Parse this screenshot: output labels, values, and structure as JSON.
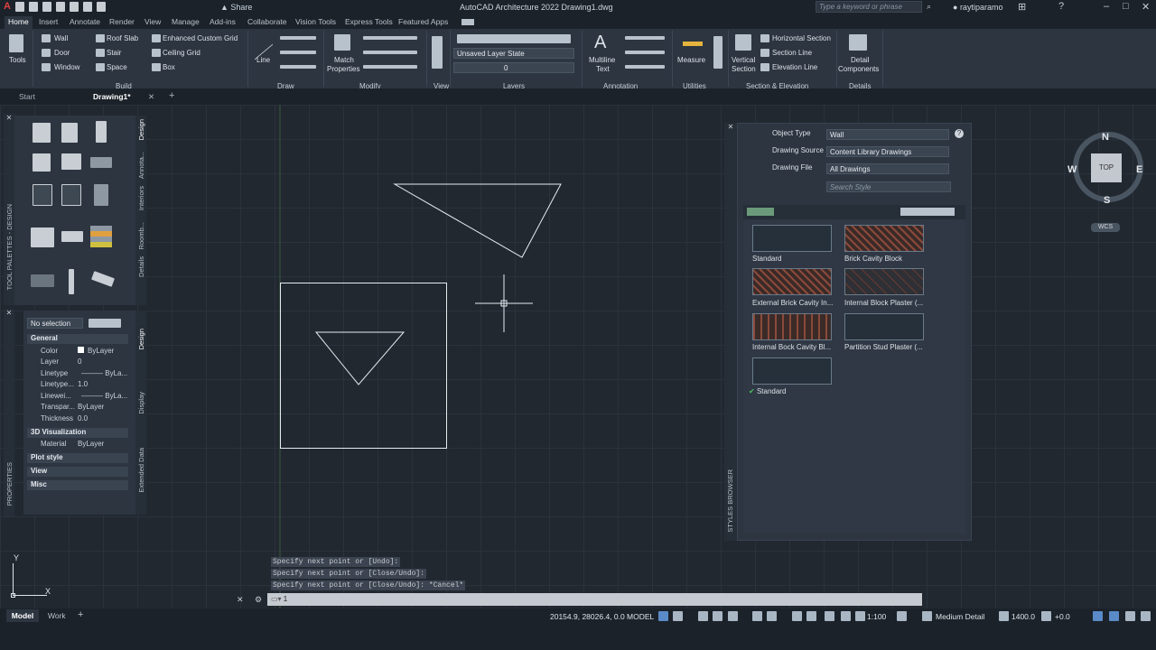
{
  "title": "AutoCAD Architecture 2022    Drawing1.dwg",
  "share": "Share",
  "search": {
    "placeholder": "Type a keyword or phrase"
  },
  "user": "raytiparamo",
  "ribbon_tabs": [
    "Home",
    "Insert",
    "Annotate",
    "Render",
    "View",
    "Manage",
    "Add-ins",
    "Collaborate",
    "Vision Tools",
    "Express Tools",
    "Featured Apps"
  ],
  "ribbon": {
    "tools": "Tools",
    "build": {
      "wall": "Wall",
      "door": "Door",
      "window": "Window",
      "roof_slab": "Roof Slab",
      "stair": "Stair",
      "space": "Space",
      "grid": "Enhanced Custom Grid",
      "ceiling_grid": "Ceiling Grid",
      "box": "Box",
      "label": "Build"
    },
    "draw": {
      "line": "Line",
      "label": "Draw"
    },
    "modify": {
      "match": "Match",
      "properties": "Properties",
      "label": "Modify"
    },
    "view": {
      "label": "View"
    },
    "layers": {
      "state": "Unsaved Layer State",
      "layer": "0",
      "label": "Layers"
    },
    "annotation": {
      "multiline": "Multiline",
      "text": "Text",
      "label": "Annotation"
    },
    "utilities": {
      "measure": "Measure",
      "label": "Utilities"
    },
    "section": {
      "vertical": "Vertical",
      "section": "Section",
      "horizontal": "Horizontal Section",
      "section_line": "Section Line",
      "elevation_line": "Elevation Line",
      "label": "Section & Elevation"
    },
    "details": {
      "detail": "Detail",
      "components": "Components",
      "label": "Details"
    }
  },
  "doc_tabs": [
    "Start",
    "Drawing1*"
  ],
  "tool_palette": {
    "title": "TOOL PALETTES - DESIGN",
    "tabs": [
      "Design",
      "Annota...",
      "Interiors",
      "Roomb...",
      "Details"
    ]
  },
  "properties": {
    "title": "PROPERTIES",
    "selection": "No selection",
    "general": "General",
    "rows": [
      {
        "k": "Color",
        "v": "ByLayer"
      },
      {
        "k": "Layer",
        "v": "0"
      },
      {
        "k": "Linetype",
        "v": "ByLa..."
      },
      {
        "k": "Linetype...",
        "v": "1.0"
      },
      {
        "k": "Linewei...",
        "v": "ByLa..."
      },
      {
        "k": "Transpar...",
        "v": "ByLayer"
      },
      {
        "k": "Thickness",
        "v": "0.0"
      }
    ],
    "viz": "3D Visualization",
    "material_k": "Material",
    "material_v": "ByLayer",
    "sections": [
      "Plot style",
      "View",
      "Misc"
    ],
    "tabs": [
      "Design",
      "Display",
      "Extended Data"
    ]
  },
  "styles_browser": {
    "title": "STYLES BROWSER",
    "object_type_label": "Object Type",
    "object_type": "Wall",
    "drawing_source_label": "Drawing Source",
    "drawing_source": "Content Library Drawings",
    "drawing_file_label": "Drawing File",
    "drawing_file": "All Drawings",
    "search_placeholder": "Search Style",
    "styles": [
      "Standard",
      "Brick Cavity Block",
      "External Brick Cavity In...",
      "Internal Block Plaster (...",
      "Internal Bock Cavity Bl...",
      "Partition Stud Plaster (..."
    ],
    "current": "Standard"
  },
  "viewcube": {
    "n": "N",
    "s": "S",
    "e": "E",
    "w": "W",
    "top": "TOP",
    "wcs": "WCS"
  },
  "command_history": [
    "Specify next point or [Undo]:",
    "Specify next point or [Close/Undo]:",
    "Specify next point or [Close/Undo]: *Cancel*"
  ],
  "command_input": "1",
  "ucs": {
    "x": "X",
    "y": "Y"
  },
  "status": {
    "coords": "20154.9, 28026.4, 0.0",
    "model": "MODEL",
    "scale": "1:100",
    "detail": "Medium Detail",
    "elev": "1400.0",
    "plus": "+0.0"
  },
  "layout_tabs": [
    "Model",
    "Work"
  ]
}
